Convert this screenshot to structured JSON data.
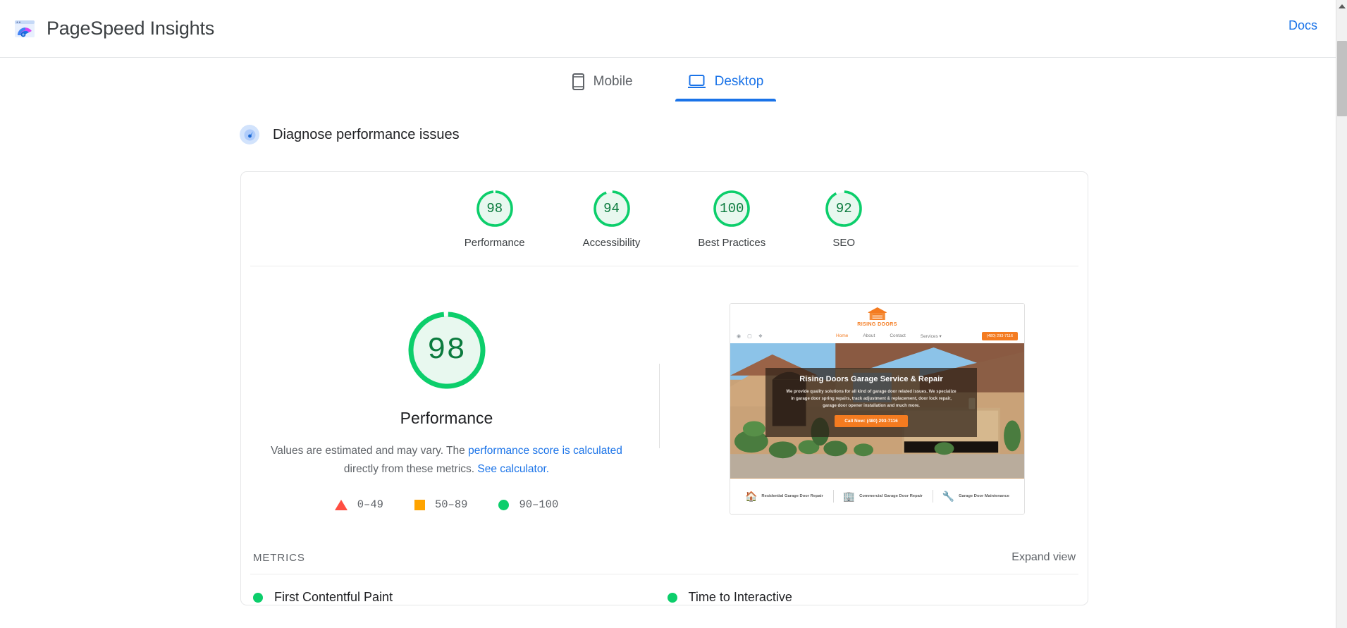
{
  "header": {
    "app_title": "PageSpeed Insights",
    "logo_icon": "pagespeed-gauge-logo",
    "docs_label": "Docs"
  },
  "tabs": [
    {
      "label": "Mobile",
      "icon": "phone-icon",
      "active": false
    },
    {
      "label": "Desktop",
      "icon": "laptop-icon",
      "active": true
    }
  ],
  "diagnose": {
    "icon": "speed-gauge-icon",
    "label": "Diagnose performance issues"
  },
  "category_scores": [
    {
      "label": "Performance",
      "value": "98",
      "color": "#0cce6b"
    },
    {
      "label": "Accessibility",
      "value": "94",
      "color": "#0cce6b"
    },
    {
      "label": "Best Practices",
      "value": "100",
      "color": "#0cce6b"
    },
    {
      "label": "SEO",
      "value": "92",
      "color": "#0cce6b"
    }
  ],
  "performance_panel": {
    "score": "98",
    "title": "Performance",
    "description_part1": "Values are estimated and may vary. The ",
    "link1": "performance score is calculated",
    "description_part2": " directly from these metrics. ",
    "link2": "See calculator.",
    "legend": [
      {
        "shape": "triangle",
        "label": "0–49",
        "color": "#ff4e42"
      },
      {
        "shape": "square",
        "label": "50–89",
        "color": "#ffa400"
      },
      {
        "shape": "circle",
        "label": "90–100",
        "color": "#0cce6b"
      }
    ]
  },
  "thumbnail": {
    "site_logo_text": "RISING DOORS",
    "social_icons": [
      "facebook-icon",
      "instagram-icon",
      "yelp-icon"
    ],
    "nav": [
      "Home",
      "About",
      "Contact",
      "Services ▾"
    ],
    "cta": "(480) 293-7116",
    "hero_heading": "Rising Doors Garage Service & Repair",
    "hero_paragraph": "We provide quality solutions for all kind of garage door related issues. We specialize in garage door spring repairs, track adjustment & replacement, door lock repair, garage door opener installation and much more.",
    "hero_button": "Call Now: (480) 293-7116",
    "features": [
      {
        "icon": "home-icon",
        "label": "Residential Garage Door Repair"
      },
      {
        "icon": "building-icon",
        "label": "Commercial Garage Door Repair"
      },
      {
        "icon": "tools-icon",
        "label": "Garage Door Maintenance"
      }
    ]
  },
  "metrics": {
    "section_title": "METRICS",
    "expand_view_label": "Expand view",
    "left_items": [
      {
        "name": "First Contentful Paint",
        "status_color": "#0cce6b"
      }
    ],
    "right_items": [
      {
        "name": "Time to Interactive",
        "status_color": "#0cce6b"
      }
    ]
  },
  "scrollbar": {
    "up_arrow_icon": "caret-up-icon"
  }
}
